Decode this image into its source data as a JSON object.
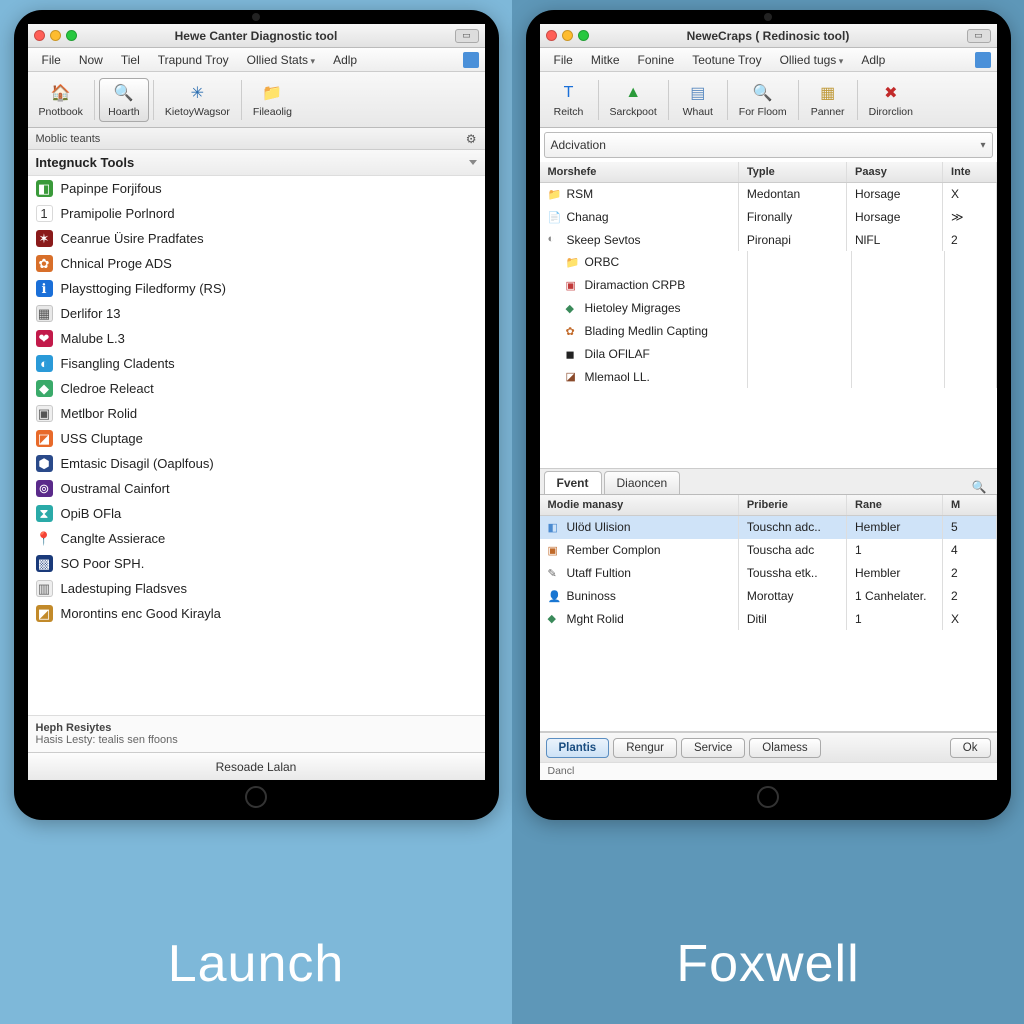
{
  "brands": {
    "left": "Launch",
    "right": "Foxwell"
  },
  "launch": {
    "title": "Hewe Canter Diagnostic tool",
    "menus": [
      "File",
      "Now",
      "Tiel",
      "Trapund Troy",
      "Ollied Stats",
      "Adlp"
    ],
    "menu_chev_index": 4,
    "toolbar": [
      {
        "label": "Pnotbook",
        "icon": "🏠",
        "color": "#2b6cb0"
      },
      {
        "label": "Hoarth",
        "icon": "🔍",
        "color": "#555",
        "active": true
      },
      {
        "label": "KietoyWagsor",
        "icon": "✳",
        "color": "#2a6db0"
      },
      {
        "label": "Fileaolig",
        "icon": "📁",
        "color": "#c08a2a"
      }
    ],
    "subbar": "Moblic teants",
    "section": "Integnuck Tools",
    "items": [
      {
        "label": "Papinpe Forjifous",
        "icon": "◧",
        "bg": "#3a9a3a",
        "fg": "#fff"
      },
      {
        "label": "Pramipolie Porlnord",
        "icon": "1",
        "bg": "#fff",
        "fg": "#333",
        "border": true
      },
      {
        "label": "Ceanrue Üsire Pradfates",
        "icon": "✶",
        "bg": "#8a1a1a",
        "fg": "#fff"
      },
      {
        "label": "Chnical Proge ADS",
        "icon": "✿",
        "bg": "#d86f2a",
        "fg": "#fff"
      },
      {
        "label": "Playsttoging Filedformy (RS)",
        "icon": "ℹ",
        "bg": "#1a6fd8",
        "fg": "#fff"
      },
      {
        "label": "Derlifor 13",
        "icon": "▦",
        "bg": "#e8e8e8",
        "fg": "#555",
        "border": true
      },
      {
        "label": "Malube L.3",
        "icon": "❤",
        "bg": "#c21a4a",
        "fg": "#fff"
      },
      {
        "label": "Fisangling Cladents",
        "icon": "◐",
        "bg": "#2a9ad8",
        "fg": "#fff"
      },
      {
        "label": "Cledroe Releact",
        "icon": "◆",
        "bg": "#3aaa6a",
        "fg": "#fff"
      },
      {
        "label": "Metlbor Rolid",
        "icon": "▣",
        "bg": "#eee",
        "fg": "#555",
        "border": true
      },
      {
        "label": "USS Cluptage",
        "icon": "◪",
        "bg": "#e86a2a",
        "fg": "#fff"
      },
      {
        "label": "Emtasic Disagil (Oaplfous)",
        "icon": "⬢",
        "bg": "#2a4a8a",
        "fg": "#fff"
      },
      {
        "label": "Oustramal Cainfort",
        "icon": "⊚",
        "bg": "#5a2a8a",
        "fg": "#fff"
      },
      {
        "label": "OpiB OFla",
        "icon": "⧗",
        "bg": "#2aaaa8",
        "fg": "#fff"
      },
      {
        "label": "Canglte Assierace",
        "icon": "📍",
        "bg": "",
        "fg": "#d84a2a"
      },
      {
        "label": "SO Poor SPH.",
        "icon": "▩",
        "bg": "#1a3a7a",
        "fg": "#fff"
      },
      {
        "label": "Ladestuping Fladsves",
        "icon": "▥",
        "bg": "#eee",
        "fg": "#666",
        "border": true
      },
      {
        "label": "Morontins enc Good Kirayla",
        "icon": "◩",
        "bg": "#c28a2a",
        "fg": "#fff"
      }
    ],
    "help": {
      "line1": "Heph Resiytes",
      "line2": "Hasis Lesty: tealis sen ffoons"
    },
    "footer_btn": "Resoade Lalan"
  },
  "foxwell": {
    "title": "NeweCraps ( Redinosic tool)",
    "menus": [
      "File",
      "Mitke",
      "Fonine",
      "Teotune Troy",
      "Ollied tugs",
      "Adlp"
    ],
    "menu_chev_index": 4,
    "toolbar": [
      {
        "label": "Reitch",
        "icon": "T",
        "color": "#1a6fd8"
      },
      {
        "label": "Sarckpoot",
        "icon": "▲",
        "color": "#2a9a3a"
      },
      {
        "label": "Whaut",
        "icon": "▤",
        "color": "#5a8ac0"
      },
      {
        "label": "For Floom",
        "icon": "🔍",
        "color": "#3a9a6a"
      },
      {
        "label": "Panner",
        "icon": "▦",
        "color": "#c09a3a"
      },
      {
        "label": "Dirorclion",
        "icon": "✖",
        "color": "#c22a2a"
      }
    ],
    "combo": "Adcivation",
    "top_columns": [
      "Morshefe",
      "Typle",
      "Paasy",
      "Inte"
    ],
    "top_rows": [
      {
        "cells": [
          "RSM",
          "Medontan",
          "Horsage",
          "X"
        ],
        "icon": "📁",
        "color": "#c9a24a"
      },
      {
        "cells": [
          "Chanag",
          "Fironally",
          "Horsage",
          "≫"
        ],
        "icon": "📄",
        "color": "#6a9ad0"
      },
      {
        "cells": [
          "Skeep Sevtos",
          "Pironapi",
          "NlFL",
          "2"
        ],
        "icon": "◐",
        "color": "#888"
      },
      {
        "cells": [
          "ORBC",
          "",
          "",
          ""
        ],
        "icon": "📁",
        "color": "#c9a24a",
        "indent": true
      },
      {
        "cells": [
          "Diramaction CRPB",
          "",
          "",
          ""
        ],
        "icon": "▣",
        "color": "#c23a3a",
        "indent": true
      },
      {
        "cells": [
          "Hietoley Migrages",
          "",
          "",
          ""
        ],
        "icon": "◆",
        "color": "#3a8a5a",
        "indent": true
      },
      {
        "cells": [
          "Blading Medlin Capting",
          "",
          "",
          ""
        ],
        "icon": "✿",
        "color": "#c26a2a",
        "indent": true
      },
      {
        "cells": [
          "Dila OFlLAF",
          "",
          "",
          ""
        ],
        "icon": "◼",
        "color": "#222",
        "indent": true
      },
      {
        "cells": [
          "Mlemaol LL.",
          "",
          "",
          ""
        ],
        "icon": "◪",
        "color": "#8a4a2a",
        "indent": true
      }
    ],
    "tabs": [
      "Fvent",
      "Diaoncen"
    ],
    "active_tab": 0,
    "bot_columns": [
      "Modie manasy",
      "Priberie",
      "Rane",
      "M"
    ],
    "bot_rows": [
      {
        "cells": [
          "Ulöd Ulision",
          "Touschn adc..",
          "Hembler",
          "5"
        ],
        "icon": "◧",
        "color": "#4a8ad0",
        "sel": true
      },
      {
        "cells": [
          "Rember Complon",
          "Touscha adc",
          "1",
          "4"
        ],
        "icon": "▣",
        "color": "#c06a2a"
      },
      {
        "cells": [
          "Utaff Fultion",
          "Toussha etk..",
          "Hembler",
          "2"
        ],
        "icon": "✎",
        "color": "#666"
      },
      {
        "cells": [
          "Buninoss",
          "Morottay",
          "1 Canhelater.",
          "2"
        ],
        "icon": "👤",
        "color": "#8a5a3a"
      },
      {
        "cells": [
          "Mght Rolid",
          "Ditil",
          "1",
          "X"
        ],
        "icon": "◆",
        "color": "#3a8a5a"
      }
    ],
    "bottom_buttons": [
      "Plantis",
      "Rengur",
      "Service",
      "Olamess",
      "Ok"
    ],
    "primary_index": 0,
    "status": "Dancl"
  }
}
